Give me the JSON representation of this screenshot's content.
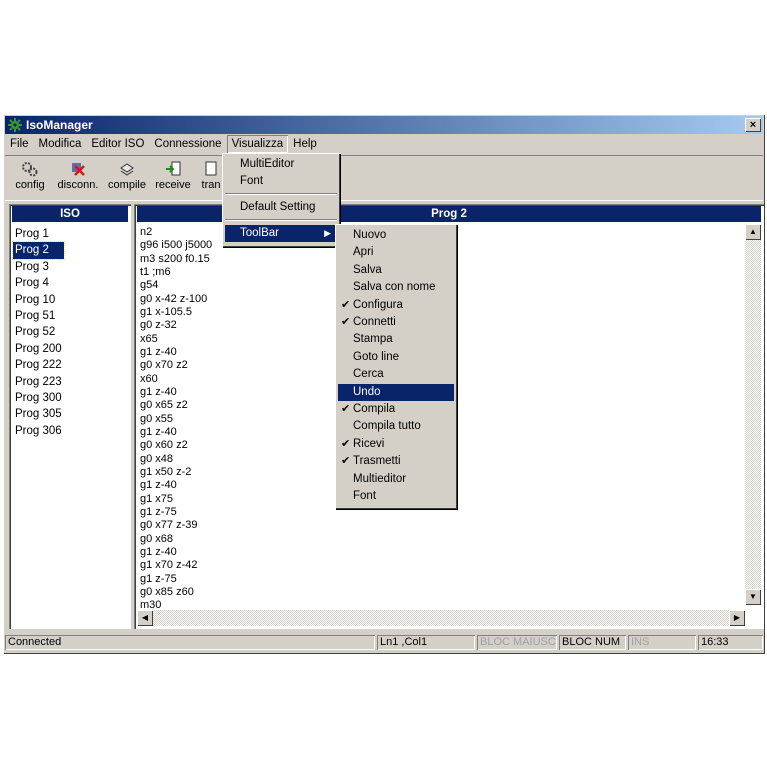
{
  "window": {
    "title": "IsoManager",
    "close": "×"
  },
  "menubar": [
    "File",
    "Modifica",
    "Editor ISO",
    "Connessione",
    "Visualizza",
    "Help"
  ],
  "toolbar": [
    {
      "label": "config"
    },
    {
      "label": "disconn."
    },
    {
      "label": "compile"
    },
    {
      "label": "receive"
    },
    {
      "label": "tran"
    }
  ],
  "left_panel": {
    "title": "ISO",
    "items": [
      "Prog 1",
      "Prog 2",
      "Prog 3",
      "Prog 4",
      "Prog 10",
      "Prog 51",
      "Prog 52",
      "Prog 200",
      "Prog 222",
      "Prog 223",
      "Prog 300",
      "Prog 305",
      "Prog 306"
    ],
    "selected": "Prog 2"
  },
  "editor": {
    "title": "Prog 2",
    "lines": [
      "n2",
      "g96 i500 j5000",
      "m3 s200 f0.15",
      "t1 ;m6",
      "g54",
      "g0 x-42 z-100",
      "g1 x-105.5",
      "g0 z-32",
      "x65",
      "g1 z-40",
      "g0 x70 z2",
      "x60",
      "g1 z-40",
      "g0 x65 z2",
      "g0 x55",
      "g1 z-40",
      "g0 x60 z2",
      "g0 x48",
      "g1 x50 z-2",
      "g1 z-40",
      "g1 x75",
      "g1 z-75",
      "g0 x77 z-39",
      "g0 x68",
      "g1 z-40",
      "g1 x70 z-42",
      "g1 z-75",
      "g0 x85 z60",
      "m30"
    ]
  },
  "visualizza_menu": {
    "items": [
      "MultiEditor",
      "Font",
      "Default Setting",
      "ToolBar"
    ]
  },
  "toolbar_submenu": {
    "items": [
      {
        "label": "Nuovo",
        "checked": false
      },
      {
        "label": "Apri",
        "checked": false
      },
      {
        "label": "Salva",
        "checked": false
      },
      {
        "label": "Salva con nome",
        "checked": false
      },
      {
        "label": "Configura",
        "checked": true
      },
      {
        "label": "Connetti",
        "checked": true
      },
      {
        "label": "Stampa",
        "checked": false
      },
      {
        "label": "Goto line",
        "checked": false
      },
      {
        "label": "Cerca",
        "checked": false
      },
      {
        "label": "Undo",
        "checked": false,
        "highlighted": true
      },
      {
        "label": "Compila",
        "checked": true
      },
      {
        "label": "Compila tutto",
        "checked": false
      },
      {
        "label": "Ricevi",
        "checked": true
      },
      {
        "label": "Trasmetti",
        "checked": true
      },
      {
        "label": "Multieditor",
        "checked": false
      },
      {
        "label": "Font",
        "checked": false
      }
    ],
    "check_glyph": "✔"
  },
  "statusbar": {
    "connection": "Connected",
    "position": "Ln1 ,Col1",
    "caps": "BLOC MAIUSC",
    "num": "BLOC NUM",
    "ins": "INS",
    "time": "16:33"
  }
}
